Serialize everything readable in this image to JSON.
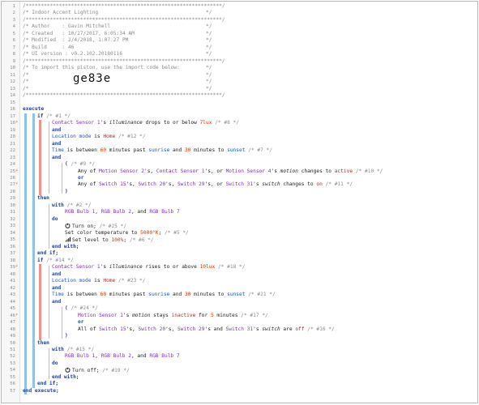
{
  "header": {
    "title": "Indoor Accent Lighting",
    "author": "Gavin Mitchell",
    "created": "10/27/2017, 6:05:34 AM",
    "modified": "2/4/2018, 1:07:27 PM",
    "build": "46",
    "ui_version": "v0.2.102.20180116",
    "import_hint": "To import this piston, use the import code below:",
    "import_code": "ge83e"
  },
  "lines": [
    "1",
    "2",
    "3",
    "4",
    "5",
    "6",
    "7",
    "8",
    "9",
    "10",
    "11",
    "12",
    "13",
    "14",
    "15",
    "16",
    "17",
    "18",
    "19",
    "20",
    "21",
    "22",
    "23",
    "24",
    "25",
    "26",
    "27",
    "28",
    "29",
    "30",
    "31",
    "32",
    "33",
    "34",
    "35",
    "36",
    "37",
    "38",
    "39",
    "40",
    "41",
    "42",
    "43",
    "44",
    "45",
    "46",
    "47",
    "48",
    "49",
    "50",
    "51",
    "52",
    "53",
    "54",
    "55",
    "56",
    "57"
  ],
  "code": {
    "stars": "/*****************************************************************/",
    "title_prefix": "/* ",
    "title_suffix": "*/",
    "author_label": "/* Author    : ",
    "created_label": "/* Created   : ",
    "modified_label": "/* Modified  : ",
    "build_label": "/* Build     : ",
    "ui_label": "/* UI version : ",
    "comment_open": "/* ",
    "comment_close": "*/",
    "slash_star": "/*",
    "star_slash": "*/",
    "kw_execute": "execute",
    "kw_if": "if",
    "kw_and": "and",
    "kw_or": "or",
    "kw_then": "then",
    "kw_with": "with",
    "kw_do": "do",
    "kw_end_with": "end with;",
    "kw_end_if": "end if;",
    "kw_end_execute": "end execute;",
    "kw_paren_open": "(",
    "kw_paren_close": ")",
    "c1": "/* #1 */",
    "c8": "/* #8 */",
    "c12": "/* #12 */",
    "c7": "/* #7 */",
    "c9": "/* #9 */",
    "c10": "/* #10 */",
    "c11": "/* #11 */",
    "c2": "/* #2 */",
    "c25": "/* #25 */",
    "c5": "/* #5 */",
    "c6": "/* #6 */",
    "c14": "/* #14 */",
    "c18": "/* #18 */",
    "c23": "/* #23 */",
    "c21": "/* #21 */",
    "c24": "/* #24 */",
    "c17": "/* #17 */",
    "c16": "/* #16 */",
    "c15": "/* #15 */",
    "c19": "/* #19 */",
    "dev_contact1": "Contact Sensor 1",
    "apos_s": "'s ",
    "illuminance": "illuminance",
    "drops_to": " drops to or below ",
    "lux7": "7lux",
    "rises_to": " rises to or above ",
    "lux10": "10lux",
    "location_mode": "Location mode",
    "is": " is ",
    "home": "Home",
    "time_between": "Time",
    "is_between": " is between ",
    "sixty": "60",
    "min_past": " minutes past ",
    "sunrise": "sunrise",
    "and_word": " and ",
    "thirty": "30",
    "min_to": " minutes to ",
    "sunset": "sunset",
    "any_of": "Any of ",
    "ms2": "Motion Sensor 2",
    "comma_sp": "'s, ",
    "cs1": "Contact Sensor 1",
    "or_sp": ", or ",
    "ms4": "Motion Sensor 4",
    "motion": "motion",
    "changes_to": " changes to ",
    "active": "active",
    "sw15": "Switch 15",
    "sw20": "Switch 20",
    "sw29": "Switch 29",
    "sw31": "Switch 31",
    "switch_word": "switch",
    "on": "on",
    "off": "off",
    "rgb1": "RGB Bulb 1",
    "rgb2": "RGB Bulb 2",
    "rgb7": "RGB Bulb 7",
    "comma": ", ",
    "and_tail": ", and ",
    "turn_on": "Turn on;",
    "turn_off": "Turn off;",
    "set_color_temp": "Set color temperature to ",
    "k5000": "5000°K",
    "semi": ";",
    "set_level": "Set level to ",
    "pct100": "100%",
    "ms1": "Motion Sensor 1",
    "stays": " stays ",
    "inactive": "inactive",
    "for_word": " for ",
    "five": "5",
    "minutes": " minutes",
    "all_of": "All of ",
    "are": " are ",
    "switch_are": "switch",
    "apos_s_plain": "'s "
  },
  "colors": {
    "accent_blue": "#1e57c8",
    "device_purple": "#7b2fbf",
    "value_red": "#b02a2a",
    "number_orange": "#cc3300",
    "comment_gray": "#8a8a8a",
    "keyword_navy": "#1e3f9b",
    "bar_blue": "#8fc1ea",
    "bar_red": "#f29088"
  },
  "icons": {
    "power_on": "power-on-icon",
    "power_off": "power-off-icon",
    "level": "signal-bars-icon",
    "marker": "lightning-marker-icon"
  }
}
